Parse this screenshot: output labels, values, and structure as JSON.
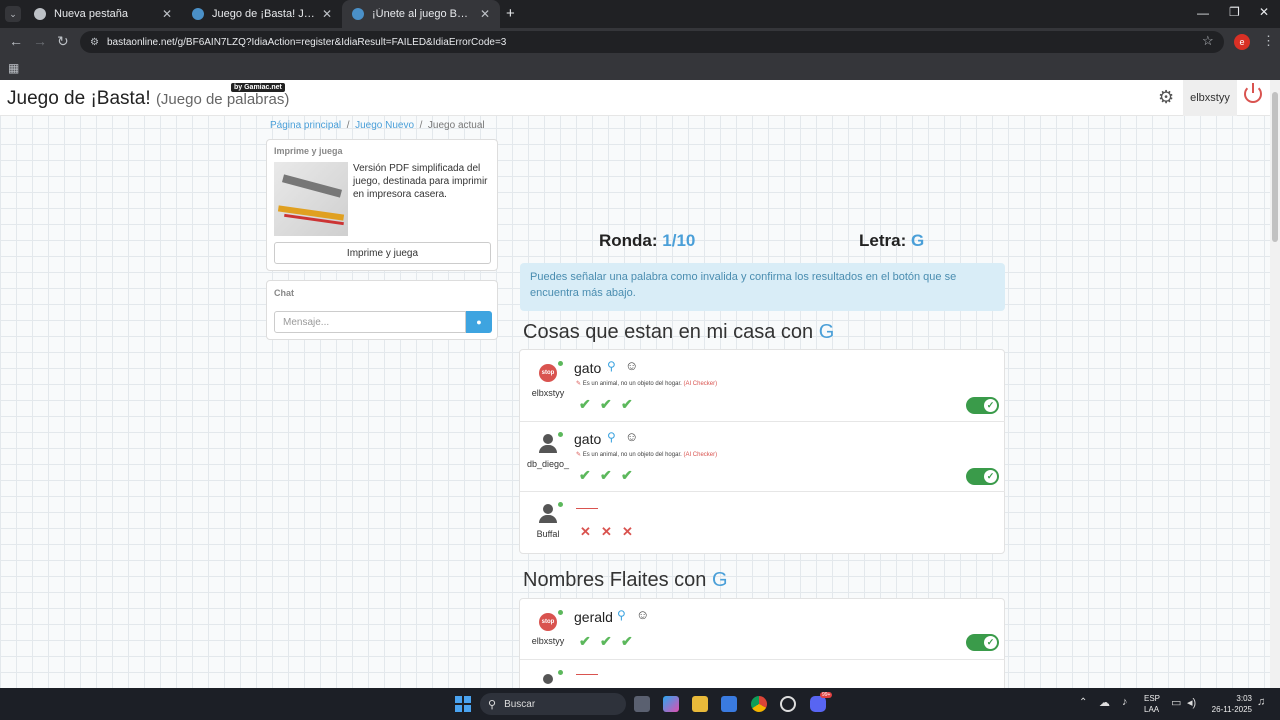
{
  "browser": {
    "tabs": [
      {
        "label": "Nueva pestaña",
        "active": false
      },
      {
        "label": "Juego de ¡Basta! Juega Stop, Tu",
        "active": false
      },
      {
        "label": "¡Únete al juego Basta!",
        "active": true
      }
    ],
    "url": "bastaonline.net/g/BF6AIN7LZQ?IdiaAction=register&IdiaResult=FAILED&IdiaErrorCode=3",
    "profile_initial": "e"
  },
  "header": {
    "title": "Juego de ¡Basta!",
    "subtitle": "(Juego de palabras)",
    "badge": "by Gamiac.net",
    "username": "elbxstyy"
  },
  "breadcrumb": {
    "home": "Página principal",
    "new": "Juego Nuevo",
    "current": "Juego actual"
  },
  "print_panel": {
    "title": "Imprime y juega",
    "description": "Versión PDF simplificada del juego, destinada para imprimir en impresora casera.",
    "button": "Imprime y juega"
  },
  "chat": {
    "title": "Chat",
    "placeholder": "Mensaje..."
  },
  "round": {
    "label": "Ronda:",
    "value": "1/10",
    "letter_label": "Letra:",
    "letter": "G"
  },
  "info_message": "Puedes señalar una palabra como invalida y confirma los resultados en el botón que se encuentra más abajo.",
  "categories": [
    {
      "title": "Cosas que estan en mi casa con",
      "letter": "G",
      "answers": [
        {
          "user": "elbxstyy",
          "word": "gato",
          "note": "Es un animal, no un objeto del hogar.",
          "checker": "(AI Checker)",
          "votes": [
            "✔",
            "✔",
            "✔"
          ]
        },
        {
          "user": "db_diego_",
          "word": "gato",
          "note": "Es un animal, no un objeto del hogar.",
          "checker": "(AI Checker)",
          "votes": [
            "✔",
            "✔",
            "✔"
          ]
        },
        {
          "user": "Buffal",
          "word": "",
          "note": "",
          "checker": "",
          "votes": [
            "✕",
            "✕",
            "✕"
          ]
        }
      ]
    },
    {
      "title": "Nombres Flaites con",
      "letter": "G",
      "answers": [
        {
          "user": "elbxstyy",
          "word": "gerald",
          "votes": [
            "✔",
            "✔",
            "✔"
          ]
        }
      ]
    }
  ],
  "taskbar": {
    "search": "Buscar",
    "lang": "ESP",
    "lang2": "LAA",
    "time": "3:03",
    "date": "26-11-2025",
    "badge_count": "99+"
  },
  "colors": {
    "accent": "#4a9fd8",
    "success": "#5cb85c",
    "danger": "#d9534f",
    "toggle": "#3a9b4a"
  },
  "icons": [
    "search-icon",
    "emoji-icon",
    "gear-icon",
    "power-icon",
    "user-icon",
    "stop-avatar-icon",
    "send-icon",
    "windows-icon"
  ]
}
